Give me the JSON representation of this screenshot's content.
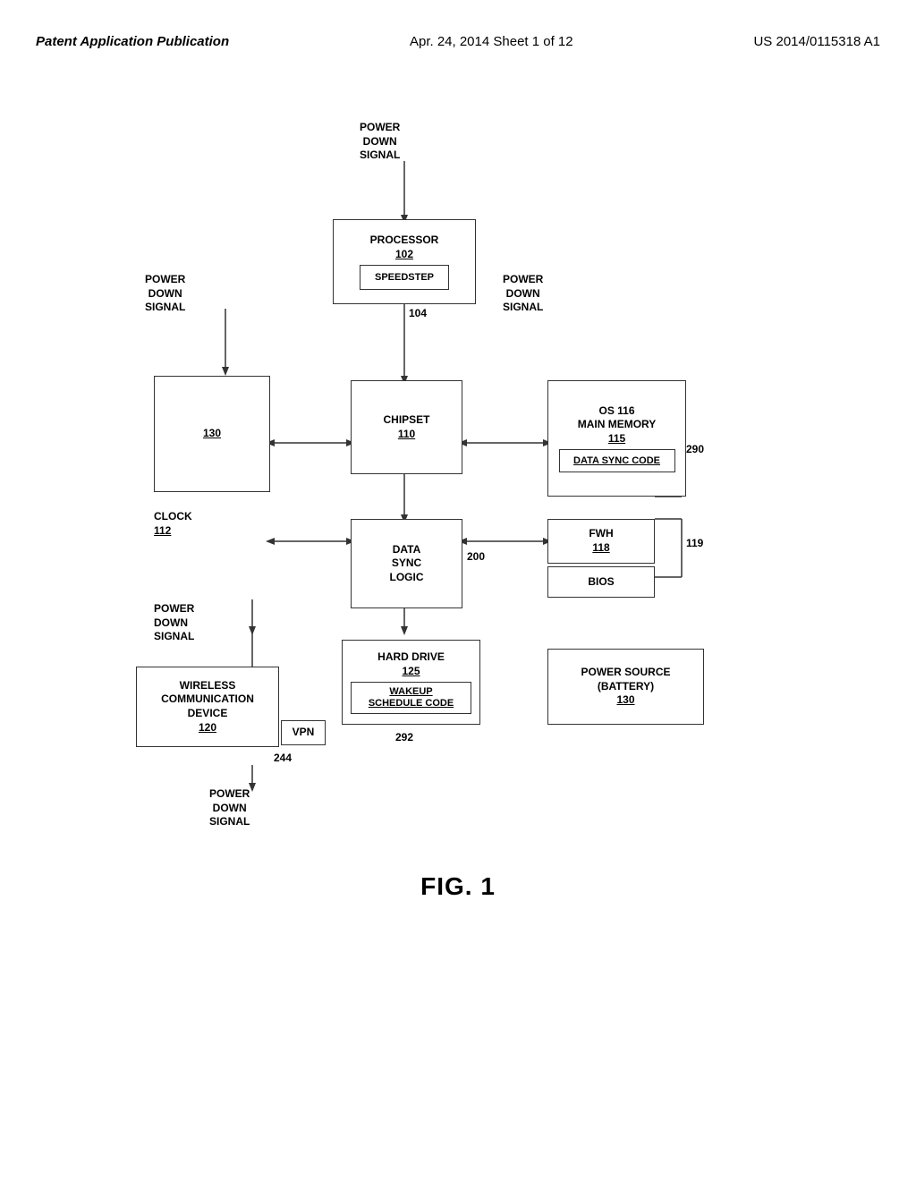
{
  "header": {
    "left": "Patent Application Publication",
    "center": "Apr. 24, 2014  Sheet 1 of 12",
    "right": "US 2014/0115318 A1"
  },
  "figure_caption": "FIG. 1",
  "labels": {
    "power_down_signal_top": "POWER\nDOWN\nSIGNAL",
    "power_down_signal_left": "POWER\nDOWN\nSIGNAL",
    "power_down_signal_right": "POWER\nDOWN\nSIGNAL",
    "power_down_signal_bottom": "POWER\nDOWN\nSIGNAL",
    "processor_label": "PROCESSOR",
    "processor_num": "102",
    "speedstep_label": "SPEEDSTEP",
    "conn_104": "104",
    "chipset_label": "CHIPSET",
    "chipset_num": "110",
    "box_130_num": "130",
    "clock_label": "CLOCK",
    "clock_num": "112",
    "data_sync_logic_label": "DATA\nSYNC\nLOGIC",
    "data_sync_logic_num": "200",
    "os_label": "OS 116",
    "main_memory_label": "MAIN MEMORY",
    "main_memory_num": "115",
    "data_sync_code_label": "DATA SYNC CODE",
    "num_290": "290",
    "fwh_label": "FWH",
    "fwh_num": "118",
    "bios_label": "BIOS",
    "num_119": "119",
    "wireless_label": "WIRELESS\nCOMMUNICATION\nDEVICE",
    "wireless_num": "120",
    "vpn_label": "VPN",
    "num_244": "244",
    "hard_drive_label": "HARD DRIVE",
    "hard_drive_num": "125",
    "wakeup_schedule_label": "WAKEUP\nSCHEDULE CODE",
    "num_292": "292",
    "power_source_label": "POWER SOURCE\n(BATTERY)",
    "power_source_num": "130"
  }
}
